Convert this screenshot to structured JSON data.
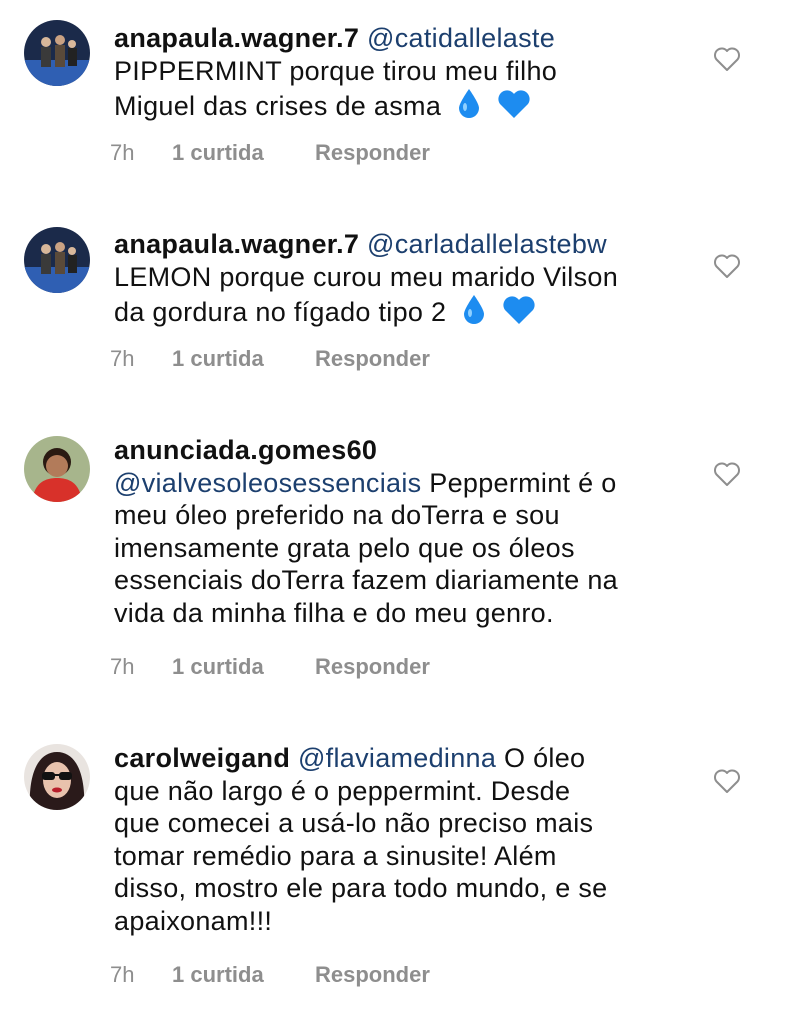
{
  "comments": [
    {
      "username": "anapaula.wagner.7",
      "mention": "@catidallelaste",
      "text_lines": [
        "PIPPERMINT porque tirou meu filho",
        "Miguel das crises de asma"
      ],
      "emojis": [
        "droplet",
        "blue-heart"
      ],
      "time": "7h",
      "likes": "1 curtida",
      "reply": "Responder"
    },
    {
      "username": "anapaula.wagner.7",
      "mention": "@carladallelastebw",
      "text_lines": [
        "LEMON porque curou meu marido Vilson",
        "da gordura no fígado tipo 2"
      ],
      "emojis": [
        "droplet",
        "blue-heart"
      ],
      "time": "7h",
      "likes": "1 curtida",
      "reply": "Responder"
    },
    {
      "username": "anunciada.gomes60",
      "mention": "@vialvesoleosessenciais",
      "text_first": "Peppermint é o",
      "text_lines": [
        "meu óleo preferido na doTerra e sou",
        "imensamente grata pelo que os óleos",
        "essenciais doTerra fazem diariamente na",
        "vida da minha filha e do meu genro."
      ],
      "time": "7h",
      "likes": "1 curtida",
      "reply": "Responder"
    },
    {
      "username": "carolweigand",
      "mention": "@flaviamedinna",
      "text_first": "O óleo",
      "text_lines": [
        "que não largo é o peppermint. Desde",
        "que comecei a usá-lo não preciso mais",
        "tomar remédio para a sinusite! Além",
        "disso, mostro ele para todo mundo, e se",
        "apaixonam!!!"
      ],
      "time": "7h",
      "likes": "1 curtida",
      "reply": "Responder"
    }
  ],
  "colors": {
    "mention": "#1c3f6e",
    "meta": "#8e8e8e",
    "emoji_blue": "#1d8cf0"
  },
  "icons": [
    "heart-outline-icon",
    "droplet-emoji",
    "blue-heart-emoji",
    "avatar"
  ]
}
